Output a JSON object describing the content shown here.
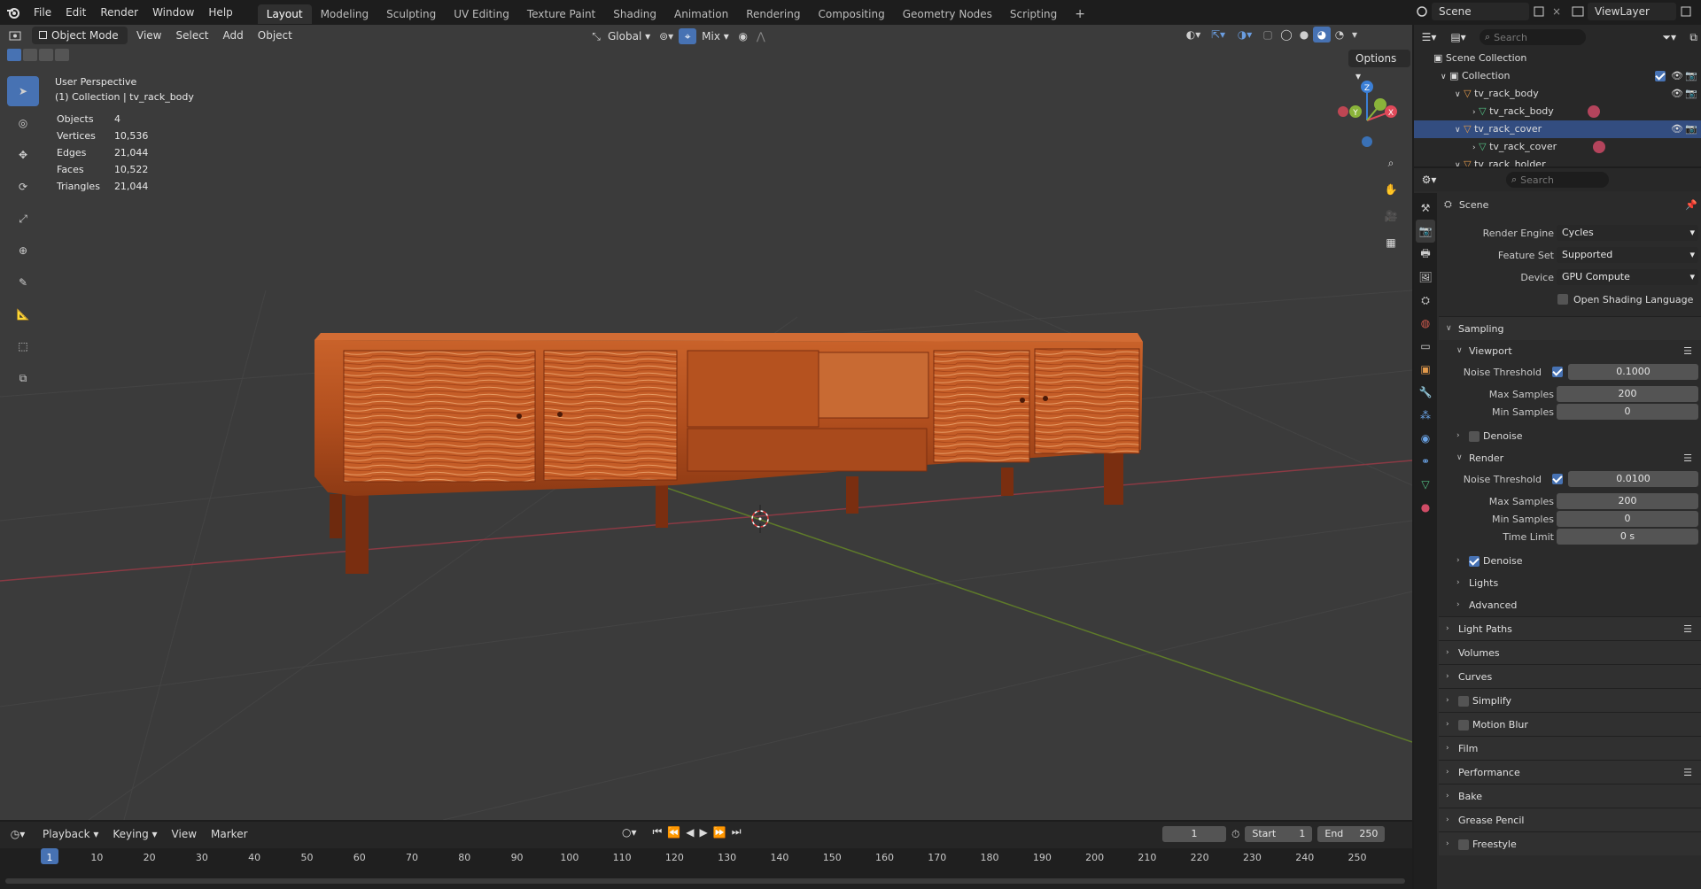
{
  "menu": [
    "File",
    "Edit",
    "Render",
    "Window",
    "Help"
  ],
  "workspaces": [
    "Layout",
    "Modeling",
    "Sculpting",
    "UV Editing",
    "Texture Paint",
    "Shading",
    "Animation",
    "Rendering",
    "Compositing",
    "Geometry Nodes",
    "Scripting"
  ],
  "active_workspace": "Layout",
  "top_right": {
    "scene": "Scene",
    "view_layer": "ViewLayer"
  },
  "viewport_header": {
    "mode": "Object Mode",
    "menus": [
      "View",
      "Select",
      "Add",
      "Object"
    ],
    "orientation": "Global",
    "snap": "Mix",
    "options": "Options"
  },
  "overlay": {
    "perspective": "User Perspective",
    "collection": "(1) Collection | tv_rack_body",
    "stats": [
      {
        "label": "Objects",
        "value": "4"
      },
      {
        "label": "Vertices",
        "value": "10,536"
      },
      {
        "label": "Edges",
        "value": "21,044"
      },
      {
        "label": "Faces",
        "value": "10,522"
      },
      {
        "label": "Triangles",
        "value": "21,044"
      }
    ]
  },
  "gizmo": {
    "x": "X",
    "y": "Y",
    "z": "Z"
  },
  "timeline": {
    "menus": [
      "Playback",
      "Keying",
      "View",
      "Marker"
    ],
    "current_frame": "1",
    "start_label": "Start",
    "start": "1",
    "end_label": "End",
    "end": "250",
    "ticks": [
      "1",
      "10",
      "20",
      "30",
      "40",
      "50",
      "60",
      "70",
      "80",
      "90",
      "100",
      "110",
      "120",
      "130",
      "140",
      "150",
      "160",
      "170",
      "180",
      "190",
      "200",
      "210",
      "220",
      "230",
      "240",
      "250"
    ]
  },
  "outliner": {
    "search_placeholder": "Search",
    "rows": [
      {
        "label": "Scene Collection"
      },
      {
        "label": "Collection"
      },
      {
        "label": "tv_rack_body"
      },
      {
        "label": "tv_rack_body"
      },
      {
        "label": "tv_rack_cover"
      },
      {
        "label": "tv_rack_cover"
      },
      {
        "label": "tv_rack_holder"
      }
    ]
  },
  "properties": {
    "search_placeholder": "Search",
    "context": "Scene",
    "render_engine_label": "Render Engine",
    "render_engine": "Cycles",
    "feature_set_label": "Feature Set",
    "feature_set": "Supported",
    "device_label": "Device",
    "device": "GPU Compute",
    "osl_label": "Open Shading Language",
    "sampling": "Sampling",
    "viewport": "Viewport",
    "noise_threshold_label": "Noise Threshold",
    "viewport_noise": "0.1000",
    "max_samples_label": "Max Samples",
    "viewport_max": "200",
    "min_samples_label": "Min Samples",
    "viewport_min": "0",
    "denoise_label": "Denoise",
    "render": "Render",
    "render_noise": "0.0100",
    "render_max": "200",
    "render_min": "0",
    "time_limit_label": "Time Limit",
    "time_limit": "0 s",
    "lights": "Lights",
    "advanced": "Advanced",
    "panels": [
      "Light Paths",
      "Volumes",
      "Curves",
      "Simplify",
      "Motion Blur",
      "Film",
      "Performance",
      "Bake",
      "Grease Pencil",
      "Freestyle"
    ]
  },
  "colors": {
    "accent": "#4772b3",
    "selected_row": "#334d80",
    "x_axis": "#e04a5a",
    "y_axis": "#8ab33a",
    "z_axis": "#3b7fd6"
  }
}
